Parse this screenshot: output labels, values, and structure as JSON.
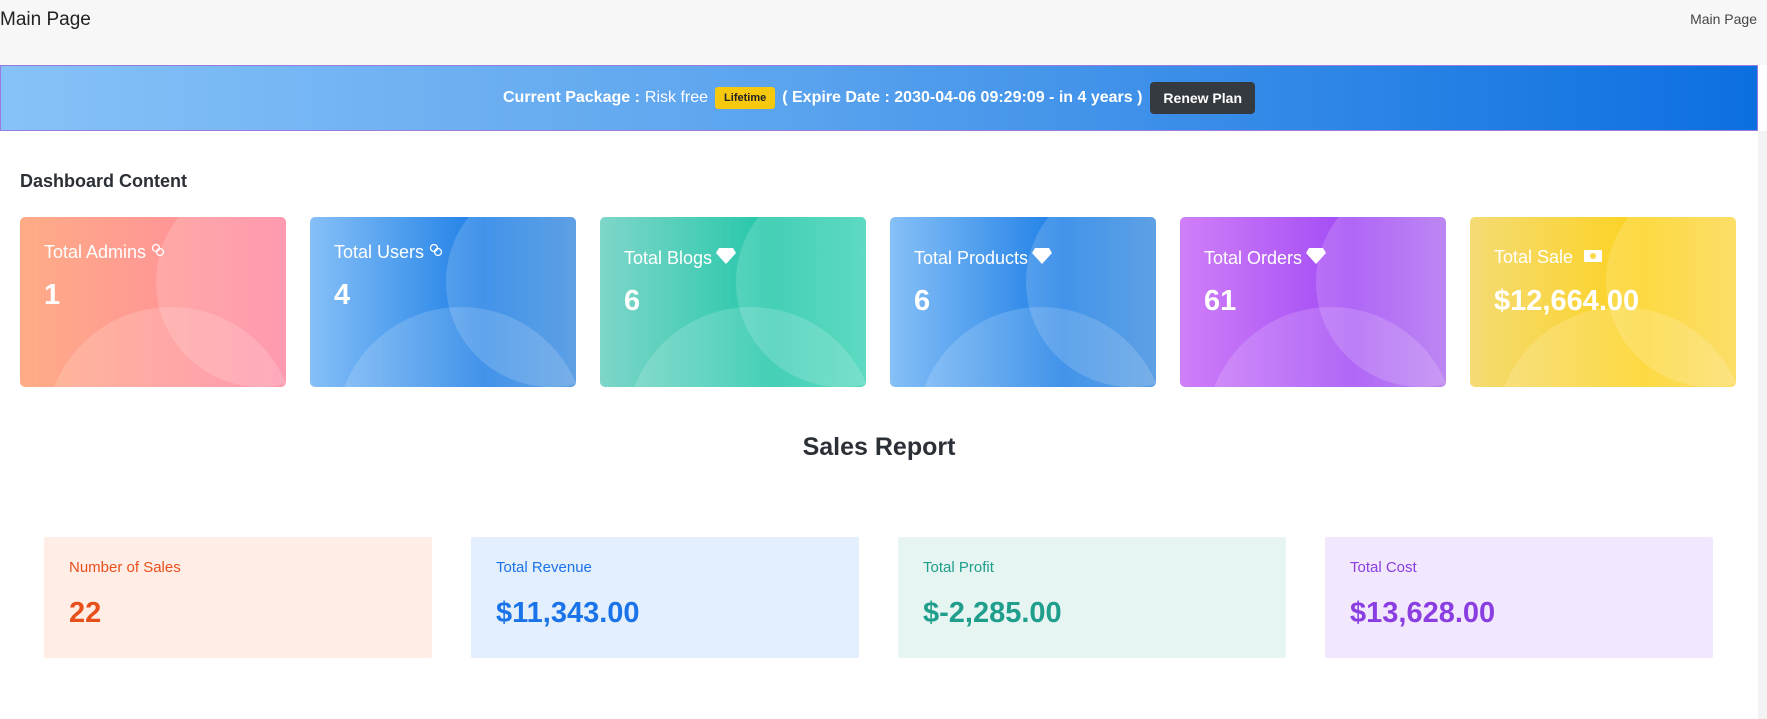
{
  "header": {
    "title": "Main Page",
    "breadcrumb": "Main Page"
  },
  "banner": {
    "package_label": "Current Package :",
    "package_name": "Risk free",
    "badge": "Lifetime",
    "expire_text": "( Expire Date : 2030-04-06 09:29:09 - in 4 years )",
    "renew_button": "Renew Plan"
  },
  "dashboard": {
    "title": "Dashboard Content",
    "cards": [
      {
        "label": "Total Admins",
        "value": "1",
        "icon": "users-icon"
      },
      {
        "label": "Total Users",
        "value": "4",
        "icon": "users-icon"
      },
      {
        "label": "Total Blogs",
        "value": "6",
        "icon": "diamond-icon"
      },
      {
        "label": "Total Products",
        "value": "6",
        "icon": "diamond-icon"
      },
      {
        "label": "Total Orders",
        "value": "61",
        "icon": "diamond-icon"
      },
      {
        "label": "Total Sale",
        "value": "$12,664.00",
        "icon": "money-icon"
      }
    ]
  },
  "sales_report": {
    "title": "Sales Report",
    "cards": [
      {
        "label": "Number of Sales",
        "value": "22",
        "color": "#e8501b"
      },
      {
        "label": "Total Revenue",
        "value": "$11,343.00",
        "color": "#1a73e8"
      },
      {
        "label": "Total Profit",
        "value": "$-2,285.00",
        "color": "#1f9e8c"
      },
      {
        "label": "Total Cost",
        "value": "$13,628.00",
        "color": "#8a3de0"
      }
    ]
  },
  "colors": {
    "banner_start": "#86c2f7",
    "banner_end": "#0c6fe0",
    "badge": "#f6c90e"
  }
}
